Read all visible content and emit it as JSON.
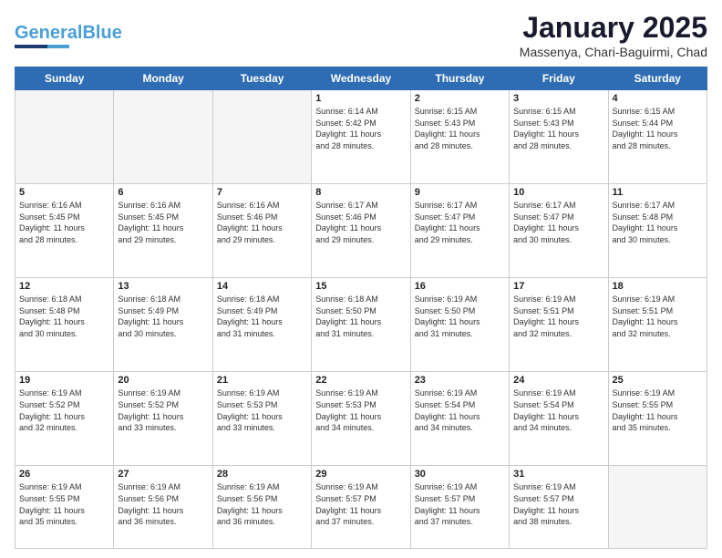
{
  "header": {
    "logo_line1": "General",
    "logo_blue": "Blue",
    "month_title": "January 2025",
    "subtitle": "Massenya, Chari-Baguirmi, Chad"
  },
  "weekdays": [
    "Sunday",
    "Monday",
    "Tuesday",
    "Wednesday",
    "Thursday",
    "Friday",
    "Saturday"
  ],
  "weeks": [
    [
      {
        "day": "",
        "info": ""
      },
      {
        "day": "",
        "info": ""
      },
      {
        "day": "",
        "info": ""
      },
      {
        "day": "1",
        "info": "Sunrise: 6:14 AM\nSunset: 5:42 PM\nDaylight: 11 hours\nand 28 minutes."
      },
      {
        "day": "2",
        "info": "Sunrise: 6:15 AM\nSunset: 5:43 PM\nDaylight: 11 hours\nand 28 minutes."
      },
      {
        "day": "3",
        "info": "Sunrise: 6:15 AM\nSunset: 5:43 PM\nDaylight: 11 hours\nand 28 minutes."
      },
      {
        "day": "4",
        "info": "Sunrise: 6:15 AM\nSunset: 5:44 PM\nDaylight: 11 hours\nand 28 minutes."
      }
    ],
    [
      {
        "day": "5",
        "info": "Sunrise: 6:16 AM\nSunset: 5:45 PM\nDaylight: 11 hours\nand 28 minutes."
      },
      {
        "day": "6",
        "info": "Sunrise: 6:16 AM\nSunset: 5:45 PM\nDaylight: 11 hours\nand 29 minutes."
      },
      {
        "day": "7",
        "info": "Sunrise: 6:16 AM\nSunset: 5:46 PM\nDaylight: 11 hours\nand 29 minutes."
      },
      {
        "day": "8",
        "info": "Sunrise: 6:17 AM\nSunset: 5:46 PM\nDaylight: 11 hours\nand 29 minutes."
      },
      {
        "day": "9",
        "info": "Sunrise: 6:17 AM\nSunset: 5:47 PM\nDaylight: 11 hours\nand 29 minutes."
      },
      {
        "day": "10",
        "info": "Sunrise: 6:17 AM\nSunset: 5:47 PM\nDaylight: 11 hours\nand 30 minutes."
      },
      {
        "day": "11",
        "info": "Sunrise: 6:17 AM\nSunset: 5:48 PM\nDaylight: 11 hours\nand 30 minutes."
      }
    ],
    [
      {
        "day": "12",
        "info": "Sunrise: 6:18 AM\nSunset: 5:48 PM\nDaylight: 11 hours\nand 30 minutes."
      },
      {
        "day": "13",
        "info": "Sunrise: 6:18 AM\nSunset: 5:49 PM\nDaylight: 11 hours\nand 30 minutes."
      },
      {
        "day": "14",
        "info": "Sunrise: 6:18 AM\nSunset: 5:49 PM\nDaylight: 11 hours\nand 31 minutes."
      },
      {
        "day": "15",
        "info": "Sunrise: 6:18 AM\nSunset: 5:50 PM\nDaylight: 11 hours\nand 31 minutes."
      },
      {
        "day": "16",
        "info": "Sunrise: 6:19 AM\nSunset: 5:50 PM\nDaylight: 11 hours\nand 31 minutes."
      },
      {
        "day": "17",
        "info": "Sunrise: 6:19 AM\nSunset: 5:51 PM\nDaylight: 11 hours\nand 32 minutes."
      },
      {
        "day": "18",
        "info": "Sunrise: 6:19 AM\nSunset: 5:51 PM\nDaylight: 11 hours\nand 32 minutes."
      }
    ],
    [
      {
        "day": "19",
        "info": "Sunrise: 6:19 AM\nSunset: 5:52 PM\nDaylight: 11 hours\nand 32 minutes."
      },
      {
        "day": "20",
        "info": "Sunrise: 6:19 AM\nSunset: 5:52 PM\nDaylight: 11 hours\nand 33 minutes."
      },
      {
        "day": "21",
        "info": "Sunrise: 6:19 AM\nSunset: 5:53 PM\nDaylight: 11 hours\nand 33 minutes."
      },
      {
        "day": "22",
        "info": "Sunrise: 6:19 AM\nSunset: 5:53 PM\nDaylight: 11 hours\nand 34 minutes."
      },
      {
        "day": "23",
        "info": "Sunrise: 6:19 AM\nSunset: 5:54 PM\nDaylight: 11 hours\nand 34 minutes."
      },
      {
        "day": "24",
        "info": "Sunrise: 6:19 AM\nSunset: 5:54 PM\nDaylight: 11 hours\nand 34 minutes."
      },
      {
        "day": "25",
        "info": "Sunrise: 6:19 AM\nSunset: 5:55 PM\nDaylight: 11 hours\nand 35 minutes."
      }
    ],
    [
      {
        "day": "26",
        "info": "Sunrise: 6:19 AM\nSunset: 5:55 PM\nDaylight: 11 hours\nand 35 minutes."
      },
      {
        "day": "27",
        "info": "Sunrise: 6:19 AM\nSunset: 5:56 PM\nDaylight: 11 hours\nand 36 minutes."
      },
      {
        "day": "28",
        "info": "Sunrise: 6:19 AM\nSunset: 5:56 PM\nDaylight: 11 hours\nand 36 minutes."
      },
      {
        "day": "29",
        "info": "Sunrise: 6:19 AM\nSunset: 5:57 PM\nDaylight: 11 hours\nand 37 minutes."
      },
      {
        "day": "30",
        "info": "Sunrise: 6:19 AM\nSunset: 5:57 PM\nDaylight: 11 hours\nand 37 minutes."
      },
      {
        "day": "31",
        "info": "Sunrise: 6:19 AM\nSunset: 5:57 PM\nDaylight: 11 hours\nand 38 minutes."
      },
      {
        "day": "",
        "info": ""
      }
    ]
  ]
}
